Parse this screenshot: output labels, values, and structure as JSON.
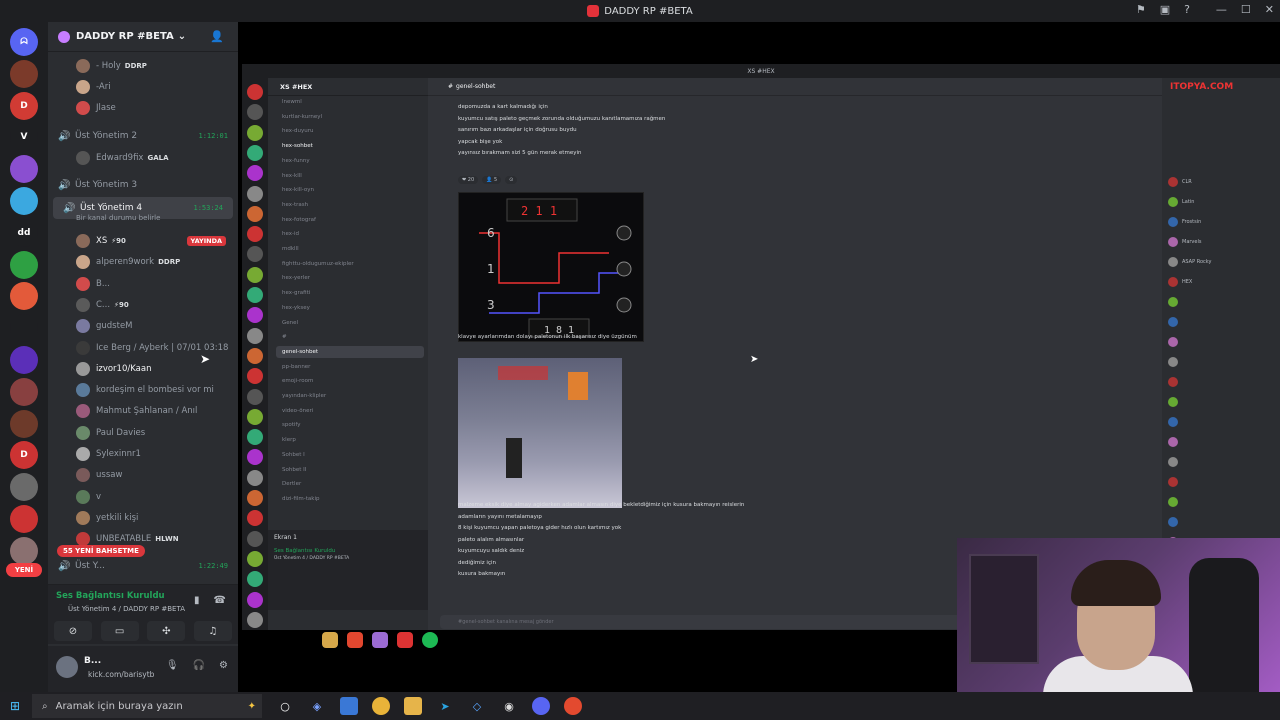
{
  "window": {
    "title": "DADDY RP #BETA"
  },
  "guild": {
    "name": "DADDY RP #BETA"
  },
  "servers": [
    {
      "badge": "",
      "color": "#5865f2",
      "glyph": "ᗣ"
    },
    {
      "badge": "1K+",
      "color": "#7b3a2a",
      "glyph": ""
    },
    {
      "badge": "9K+",
      "color": "#d13b34",
      "glyph": "D"
    },
    {
      "badge": "",
      "color": "#1e1f22",
      "glyph": "V"
    },
    {
      "badge": "196",
      "color": "#8a4fd0",
      "glyph": ""
    },
    {
      "badge": "",
      "color": "#3ba8e0",
      "glyph": ""
    },
    {
      "badge": "",
      "color": "#1e1f22",
      "glyph": "dd"
    },
    {
      "badge": "1",
      "color": "#2ea043",
      "glyph": ""
    },
    {
      "badge": "31",
      "color": "#e35a3a",
      "glyph": ""
    },
    {
      "badge": "67",
      "color": "#1e1f22",
      "glyph": ""
    },
    {
      "badge": "",
      "color": "#5b2fb8",
      "glyph": ""
    },
    {
      "badge": "4",
      "color": "#884040",
      "glyph": ""
    },
    {
      "badge": "70",
      "color": "#6d3a2a",
      "glyph": ""
    },
    {
      "badge": "56",
      "color": "#c33",
      "glyph": "D"
    },
    {
      "badge": "27",
      "color": "#6a6a6a",
      "glyph": ""
    },
    {
      "badge": "1",
      "color": "#c33",
      "glyph": ""
    },
    {
      "badge": "",
      "color": "#8a7070",
      "glyph": ""
    }
  ],
  "new_pill": "YENİ",
  "voice": {
    "top_members": [
      {
        "name": "- Holy",
        "tag": "DDRP",
        "tag_icon": "⚡"
      },
      {
        "name": "-Ari",
        "tag": "",
        "tag_icon": ""
      },
      {
        "name": "Jlase",
        "tag": "",
        "tag_icon": ""
      }
    ],
    "ch2": {
      "name": "Üst Yönetim 2",
      "timer": "1:12:01"
    },
    "ch2_member": {
      "name": "Edward9fix",
      "tag": "GALA"
    },
    "ch3": {
      "name": "Üst Yönetim 3"
    },
    "ch4": {
      "name": "Üst Yönetim 4",
      "timer": "1:53:24",
      "status": "Bir kanal durumu belirle"
    },
    "ch4_members": [
      {
        "name": "XS",
        "tag": "⚡90",
        "live": "YAYINDA"
      },
      {
        "name": "alperen9work",
        "tag": "DDRP"
      },
      {
        "name": "B...",
        "tag": ""
      },
      {
        "name": "C...",
        "tag": "⚡90"
      },
      {
        "name": "gudsteM",
        "tag": ""
      },
      {
        "name": "Ice Berg / Ayberk | 07/01 03:18",
        "tag": ""
      },
      {
        "name": "izvor10/Kaan",
        "tag": ""
      },
      {
        "name": "kordeşim el bombesi vor mi",
        "tag": ""
      },
      {
        "name": "Mahmut Şahlanan / Anıl",
        "tag": ""
      },
      {
        "name": "Paul Davies",
        "tag": ""
      },
      {
        "name": "Sylexinnr1",
        "tag": ""
      },
      {
        "name": "ussaw",
        "tag": ""
      },
      {
        "name": "v",
        "tag": ""
      },
      {
        "name": "yetkili kişi",
        "tag": ""
      },
      {
        "name": "UNBEATABLE",
        "tag": "HLWN"
      }
    ],
    "ch5": {
      "name": "Üst Y...",
      "timer": "1:22:49"
    },
    "new_mentions": "55 YENİ BAHSETME"
  },
  "voice_panel": {
    "status": "Ses Bağlantısı Kuruldu",
    "sub": "Üst Yönetim 4 / DADDY RP #BETA"
  },
  "user": {
    "name": "B...",
    "status": "kick.com/barisytb"
  },
  "stream": {
    "title": "XS #HEX",
    "guild": "XS #HEX",
    "channels": [
      "lnewml",
      "kurtlar-kurneyl",
      "hex-duyuru",
      "hex-sohbet",
      "hex-funny",
      "hex-klll",
      "hex-kill-oyn",
      "hex-trash",
      "hex-fotograf",
      "hex-id",
      "mdklll",
      "fighttu-oldugumuz-ekipler",
      "hex-yerler",
      "hex-grafiti",
      "hex-yksey",
      "Genel",
      "#",
      "genel-sohbet",
      "pp-banner",
      "emoji-room",
      "yayından-klipler",
      "video-öneri",
      "spotify",
      "klerp",
      "Sohbet I",
      "Sohbet II",
      "Dertler",
      "dizi-film-takip"
    ],
    "chat_header": "genel-sohbet",
    "messages_top": [
      "depomuzda a kart kalmadığı için",
      "kuyumcu satış paleto geçmek zorunda olduğumuzu kanıtlamamıza rağmen",
      "sanırım bazı arkadaşlar için doğrusu buydu",
      "yapcak bişe yok",
      "yayınsız bırakmam sizi 5 gün merak etmeyin"
    ],
    "reactions": [
      "❤ 20",
      "👤 5",
      "⊙"
    ],
    "game_labels": {
      "top": "2 1 1",
      "left": [
        "6",
        "1",
        "3"
      ],
      "bottom": "1 8 1"
    },
    "msg_mid": "klavye ayarlarımdan dolayı paletonun ilk başarısız diye üzgünüm",
    "messages_bottom": [
      "malzeme eksik diye almay agiderken adamlar almasın diye bekletdiğimiz için kusura bakmayın reislerin",
      "adamların yayını metalamayıp",
      "8 kişi kuyumcu yapan paletoya gider hızlı olun kartımız yok",
      "paleto alalım almasınlar",
      "kuyumcuyu saldık deniz",
      "dediğimiz için",
      "kusura bakmayın"
    ],
    "input_placeholder": "#genel-sohbet kanalına mesaj gönder",
    "voice_label": "Ekran 1",
    "voice_status": "Ses Bağlantısı Kuruldu",
    "voice_sub": "Üst Yönetim 4 / DADDY RP #BETA",
    "members": [
      "CLR",
      "Latin",
      "Frostsin",
      "Marvels",
      "ASAP Rocky",
      "HEX",
      "",
      "",
      "",
      "",
      "",
      "",
      "",
      "",
      "",
      "",
      "",
      "",
      "",
      ""
    ],
    "watermark": "ITOPYA.COM"
  },
  "taskbar": {
    "search": "Aramak için buraya yazın"
  }
}
